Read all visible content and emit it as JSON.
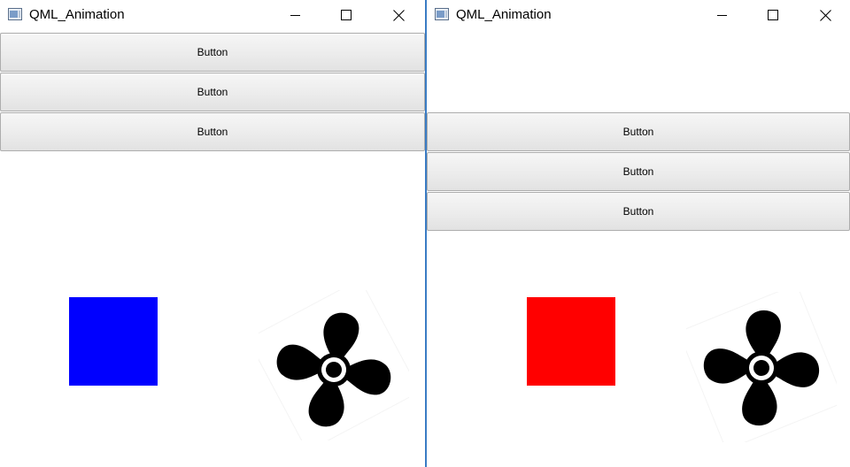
{
  "windows": [
    {
      "title": "QML_Animation",
      "icon": "app-window-icon",
      "controls": [
        "minimize-icon",
        "maximize-icon",
        "close-icon"
      ],
      "buttons": [
        {
          "label": "Button"
        },
        {
          "label": "Button"
        },
        {
          "label": "Button"
        }
      ],
      "square_color": "#0000ff",
      "fan_icon": "fan-icon"
    },
    {
      "title": "QML_Animation",
      "icon": "app-window-icon",
      "controls": [
        "minimize-icon",
        "maximize-icon",
        "close-icon"
      ],
      "buttons": [
        {
          "label": "Button"
        },
        {
          "label": "Button"
        },
        {
          "label": "Button"
        }
      ],
      "square_color": "#ff0000",
      "fan_icon": "fan-icon"
    }
  ],
  "colors": {
    "window_border_accent": "#3a7cc4",
    "fan": "#000000"
  }
}
